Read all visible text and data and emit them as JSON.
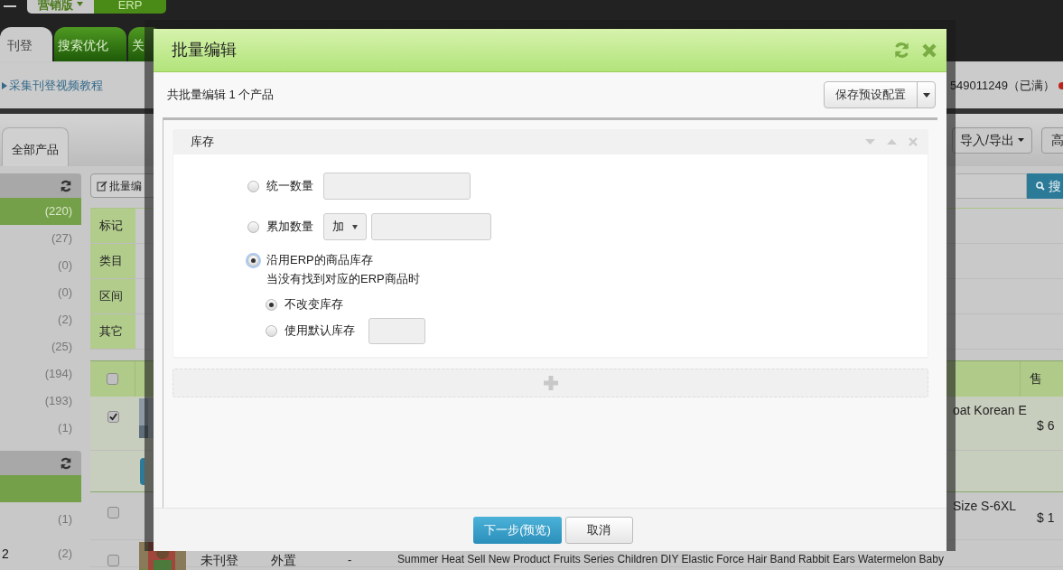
{
  "top_bar": {
    "edition_tab": "营销版",
    "erp_tab": "ERP"
  },
  "main_tabs": [
    {
      "label": "刊登",
      "selected": true
    },
    {
      "label": "搜索优化",
      "selected": false
    },
    {
      "label": "关",
      "selected": false
    }
  ],
  "info_bar": {
    "tutorial_link": "采集刊登视频教程",
    "account": "549011249（已满）"
  },
  "product_tabs": [
    {
      "label": "全部产品",
      "selected": true
    }
  ],
  "toolbar": {
    "batch_edit": "批量编",
    "import_export": "导入/导出",
    "advanced": "高",
    "search": "搜"
  },
  "sidebar": {
    "groups": [
      {
        "items": [
          {
            "count": "(220)",
            "selected": true
          },
          {
            "count": "(27)",
            "selected": false
          },
          {
            "count": "(0)",
            "selected": false
          },
          {
            "count": "(0)",
            "selected": false
          },
          {
            "count": "(2)",
            "selected": false
          },
          {
            "count": "(25)",
            "selected": false
          },
          {
            "count": "(194)",
            "selected": false
          },
          {
            "count": "(193)",
            "selected": false
          },
          {
            "count": "(1)",
            "selected": false
          }
        ]
      },
      {
        "items": [
          {
            "selected": true
          },
          {
            "count": "(1)",
            "selected": false
          },
          {
            "label": "2",
            "count": "(2)",
            "selected": false
          }
        ]
      }
    ]
  },
  "filters": [
    "标记",
    "类目",
    "区间",
    "其它"
  ],
  "table": {
    "header": {
      "checked": false,
      "column_price": "售"
    },
    "rows": [
      {
        "checked": true,
        "picture": true,
        "title": "oat Korean E",
        "price": "$ 6",
        "has_action_row": true
      },
      {
        "checked": false,
        "picture": false,
        "title": "Size S-6XL",
        "price": "$ 1",
        "has_action_row": false
      },
      {
        "checked": false,
        "picture": true,
        "status": "未刊登",
        "source": "外置",
        "column_5": "-",
        "title": "Summer Heat Sell New Product Fruits Series Children DIY Elastic Force Hair Band Rabbit Ears Watermelon Baby",
        "has_action_row": false
      }
    ]
  },
  "dialog": {
    "title": "批量编辑",
    "summary": "共批量编辑 1 个产品",
    "save_preset_button": "保存预设配置",
    "section": {
      "title": "库存",
      "options": [
        {
          "kind": "input",
          "label": "统一数量",
          "selected": false
        },
        {
          "kind": "select_input",
          "label": "累加数量",
          "select_value": "加",
          "selected": false
        },
        {
          "kind": "erp",
          "label": "沿用ERP的商品库存",
          "selected": true,
          "note": "当没有找到对应的ERP商品时",
          "sub_options": [
            {
              "kind": "plain",
              "label": "不改变库存",
              "selected": true
            },
            {
              "kind": "input",
              "label": "使用默认库存",
              "selected": false
            }
          ]
        }
      ]
    },
    "buttons": {
      "next": "下一步(预览)",
      "cancel": "取消"
    }
  }
}
